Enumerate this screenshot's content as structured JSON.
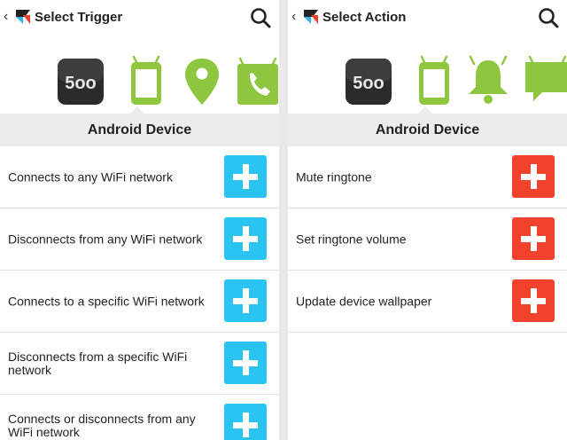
{
  "left": {
    "back_glyph": "‹",
    "title": "Select Trigger",
    "section_title": "Android Device",
    "icons": [
      "500px-icon",
      "android-device-icon",
      "location-pin-icon",
      "phone-call-icon"
    ],
    "items": [
      {
        "label": "Connects to any WiFi network"
      },
      {
        "label": "Disconnects from any WiFi network"
      },
      {
        "label": "Connects to a specific WiFi network"
      },
      {
        "label": "Disconnects from a specific WiFi network"
      },
      {
        "label": "Connects or disconnects from any WiFi network"
      }
    ]
  },
  "right": {
    "back_glyph": "‹",
    "title": "Select Action",
    "section_title": "Android Device",
    "icons": [
      "500px-icon",
      "android-device-icon",
      "notification-bell-icon",
      "sms-message-icon"
    ],
    "items": [
      {
        "label": "Mute ringtone"
      },
      {
        "label": "Set ringtone volume"
      },
      {
        "label": "Update device wallpaper"
      }
    ]
  },
  "icon_text": {
    "brand_500": "5oo"
  },
  "colors": {
    "android_green": "#8ec63f",
    "trigger_add": "#29c4f1",
    "action_add": "#f2422c",
    "section_bg": "#ececec"
  }
}
